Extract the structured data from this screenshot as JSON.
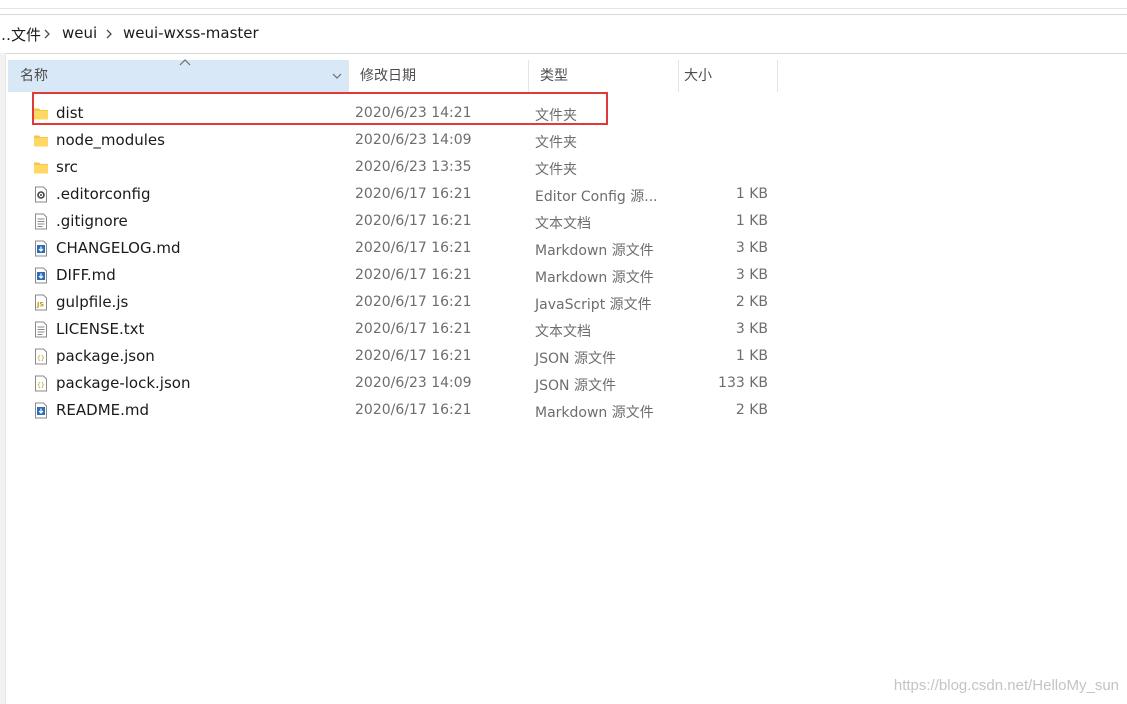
{
  "breadcrumb": {
    "items": [
      "…文件",
      "weui",
      "weui-wxss-master"
    ]
  },
  "columns": {
    "name": "名称",
    "date": "修改日期",
    "type": "类型",
    "size": "大小"
  },
  "files": [
    {
      "name": "dist",
      "date": "2020/6/23 14:21",
      "type": "文件夹",
      "size": "",
      "icon": "folder-icon"
    },
    {
      "name": "node_modules",
      "date": "2020/6/23 14:09",
      "type": "文件夹",
      "size": "",
      "icon": "folder-icon"
    },
    {
      "name": "src",
      "date": "2020/6/23 13:35",
      "type": "文件夹",
      "size": "",
      "icon": "folder-icon"
    },
    {
      "name": ".editorconfig",
      "date": "2020/6/17 16:21",
      "type": "Editor Config 源...",
      "size": "1 KB",
      "icon": "config-file-icon"
    },
    {
      "name": ".gitignore",
      "date": "2020/6/17 16:21",
      "type": "文本文档",
      "size": "1 KB",
      "icon": "text-file-icon"
    },
    {
      "name": "CHANGELOG.md",
      "date": "2020/6/17 16:21",
      "type": "Markdown 源文件",
      "size": "3 KB",
      "icon": "markdown-file-icon"
    },
    {
      "name": "DIFF.md",
      "date": "2020/6/17 16:21",
      "type": "Markdown 源文件",
      "size": "3 KB",
      "icon": "markdown-file-icon"
    },
    {
      "name": "gulpfile.js",
      "date": "2020/6/17 16:21",
      "type": "JavaScript 源文件",
      "size": "2 KB",
      "icon": "js-file-icon"
    },
    {
      "name": "LICENSE.txt",
      "date": "2020/6/17 16:21",
      "type": "文本文档",
      "size": "3 KB",
      "icon": "text-file-icon"
    },
    {
      "name": "package.json",
      "date": "2020/6/17 16:21",
      "type": "JSON 源文件",
      "size": "1 KB",
      "icon": "json-file-icon"
    },
    {
      "name": "package-lock.json",
      "date": "2020/6/23 14:09",
      "type": "JSON 源文件",
      "size": "133 KB",
      "icon": "json-file-icon"
    },
    {
      "name": "README.md",
      "date": "2020/6/17 16:21",
      "type": "Markdown 源文件",
      "size": "2 KB",
      "icon": "markdown-file-icon"
    }
  ],
  "highlight_color": "#e03b3b",
  "header_selected_color": "#d9e8f7",
  "watermark": "https://blog.csdn.net/HelloMy_sun"
}
